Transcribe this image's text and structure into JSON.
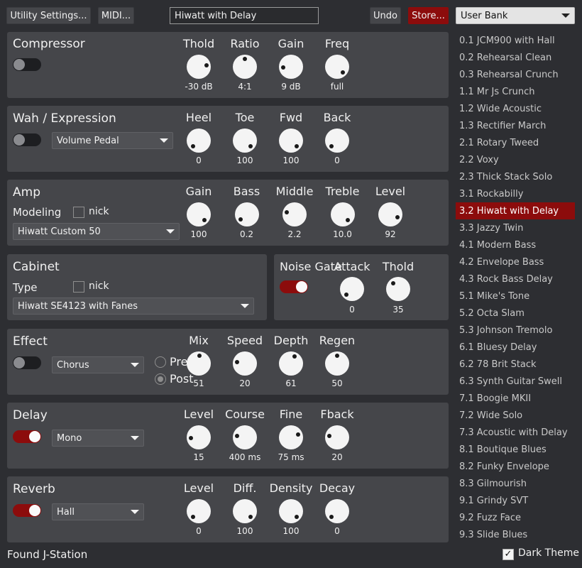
{
  "toolbar": {
    "utility_label": "Utility Settings...",
    "midi_label": "MIDI...",
    "patch_name": "Hiwatt with Delay",
    "undo_label": "Undo",
    "store_label": "Store...",
    "bank_selected": "User Bank"
  },
  "compressor": {
    "title": "Compressor",
    "enabled": false,
    "knobs": [
      {
        "label": "Thold",
        "value": "-30 dB",
        "icon": "knob",
        "level": 0.8
      },
      {
        "label": "Ratio",
        "value": "4:1",
        "icon": "knob",
        "level": 0.5
      },
      {
        "label": "Gain",
        "value": "9 dB",
        "icon": "knob",
        "level": 0.15
      },
      {
        "label": "Freq",
        "value": "full",
        "icon": "knob",
        "level": 1.0
      }
    ]
  },
  "wah": {
    "title": "Wah / Expression",
    "enabled": false,
    "mode": "Volume Pedal",
    "knobs": [
      {
        "label": "Heel",
        "value": "0",
        "level": 0.0
      },
      {
        "label": "Toe",
        "value": "100",
        "level": 1.0
      },
      {
        "label": "Fwd",
        "value": "100",
        "level": 1.0
      },
      {
        "label": "Back",
        "value": "0",
        "level": 0.0
      }
    ]
  },
  "amp": {
    "title": "Amp",
    "modeling_label": "Modeling",
    "nick_label": "nick",
    "nick_checked": false,
    "model": "Hiwatt Custom 50",
    "knobs": [
      {
        "label": "Gain",
        "value": "100",
        "level": 1.0
      },
      {
        "label": "Bass",
        "value": "0.2",
        "level": 0.02
      },
      {
        "label": "Middle",
        "value": "2.2",
        "level": 0.22
      },
      {
        "label": "Treble",
        "value": "10.0",
        "level": 1.0
      },
      {
        "label": "Level",
        "value": "92",
        "level": 0.92
      }
    ]
  },
  "cabinet": {
    "title": "Cabinet",
    "type_label": "Type",
    "nick_label": "nick",
    "nick_checked": false,
    "model": "Hiwatt SE4123 with Fanes"
  },
  "noise_gate": {
    "title": "Noise Gate",
    "enabled": true,
    "knobs": [
      {
        "label": "Attack",
        "value": "0",
        "level": 0.0
      },
      {
        "label": "Thold",
        "value": "35",
        "level": 0.35
      }
    ]
  },
  "effect": {
    "title": "Effect",
    "enabled": false,
    "type": "Chorus",
    "pre_label": "Pre",
    "post_label": "Post",
    "position": "Post",
    "knobs": [
      {
        "label": "Mix",
        "value": "51",
        "level": 0.51
      },
      {
        "label": "Speed",
        "value": "20",
        "level": 0.2
      },
      {
        "label": "Depth",
        "value": "61",
        "level": 0.61
      },
      {
        "label": "Regen",
        "value": "50",
        "level": 0.5
      }
    ]
  },
  "delay": {
    "title": "Delay",
    "enabled": true,
    "type": "Mono",
    "knobs": [
      {
        "label": "Level",
        "value": "15",
        "level": 0.15
      },
      {
        "label": "Course",
        "value": "400 ms",
        "level": 0.2
      },
      {
        "label": "Fine",
        "value": "75 ms",
        "level": 0.75
      },
      {
        "label": "Fback",
        "value": "20",
        "level": 0.2
      }
    ]
  },
  "reverb": {
    "title": "Reverb",
    "enabled": true,
    "type": "Hall",
    "knobs": [
      {
        "label": "Level",
        "value": "0",
        "level": 0.0
      },
      {
        "label": "Diff.",
        "value": "100",
        "level": 1.0
      },
      {
        "label": "Density",
        "value": "100",
        "level": 1.0
      },
      {
        "label": "Decay",
        "value": "0",
        "level": 0.0
      }
    ]
  },
  "presets": [
    "0.1 JCM900 with Hall",
    "0.2 Rehearsal Clean",
    "0.3 Rehearsal Crunch",
    "1.1 Mr Js Crunch",
    "1.2 Wide Acoustic",
    "1.3 Rectifier March",
    "2.1 Rotary Tweed",
    "2.2 Voxy",
    "2.3 Thick Stack Solo",
    "3.1 Rockabilly",
    "3.2 Hiwatt with Delay",
    "3.3 Jazzy Twin",
    "4.1 Modern Bass",
    "4.2 Envelope Bass",
    "4.3 Rock Bass Delay",
    "5.1 Mike's Tone",
    "5.2 Octa Slam",
    "5.3 Johnson Tremolo",
    "6.1 Bluesy Delay",
    "6.2 78 Brit Stack",
    "6.3 Synth Guitar Swell",
    "7.1 Boogie MKII",
    "7.2 Wide Solo",
    "7.3 Acoustic with Delay",
    "8.1 Boutique Blues",
    "8.2 Funky Envelope",
    "8.3 Gilmourish",
    "9.1 Grindy SVT",
    "9.2 Fuzz Face",
    "9.3 Slide Blues"
  ],
  "selected_preset_index": 10,
  "status": {
    "text": "Found J-Station",
    "dark_theme_label": "Dark Theme",
    "dark_theme_checked": true
  },
  "colors": {
    "background": "#2d2e32",
    "panel": "#45464a",
    "accent": "#8c0c0c",
    "knob": "#f4f4f4"
  }
}
